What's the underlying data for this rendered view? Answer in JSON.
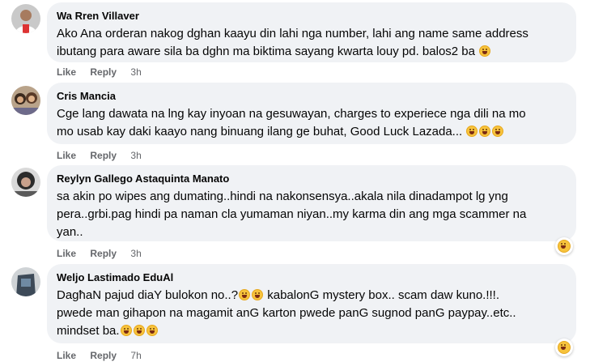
{
  "comments": [
    {
      "author": "Wa Rren Villaver",
      "lines": [
        "Ako Ana orderan nakog dghan kaayu din lahi nga number, lahi ang name same address",
        "ibutang para aware sila ba dghn ma biktima sayang kwarta louy pd. balos2 ba"
      ],
      "like": "Like",
      "reply": "Reply",
      "time": "3h"
    },
    {
      "author": "Cris Mancia",
      "lines": [
        "Cge lang dawata na lng kay inyoan na gesuwayan, charges to experiece nga dili na mo",
        "mo usab kay daki kaayo nang binuang ilang ge buhat, Good Luck Lazada..."
      ],
      "like": "Like",
      "reply": "Reply",
      "time": "3h"
    },
    {
      "author": "Reylyn Gallego Astaquinta Manato",
      "lines": [
        "sa akin po wipes ang dumating..hindi na nakonsensya..akala nila dinadampot lg yng",
        "pera..grbi.pag hindi pa naman cla yumaman niyan..my karma din ang mga scammer na",
        "yan.."
      ],
      "like": "Like",
      "reply": "Reply",
      "time": "3h"
    },
    {
      "author": "Weljo Lastimado EduAl",
      "lines": [
        "DagħaN pajud diaY bulokon no..?",
        "pwede man gihapon na magamit anG karton pwede panG sugnod panG paypay..etc..",
        "mindset ba."
      ],
      "line1_suffix": " kabalonG mystery box.. scam daw kuno.!!!.",
      "like": "Like",
      "reply": "Reply",
      "time": "7h"
    }
  ],
  "colors": {
    "bubble": "#f0f2f5",
    "meta": "#65676b",
    "emoji": "#f7c33c"
  },
  "icons": [
    "laughing-emoji",
    "grinning-emoji",
    "rofl-emoji",
    "haha-reaction-icon"
  ]
}
